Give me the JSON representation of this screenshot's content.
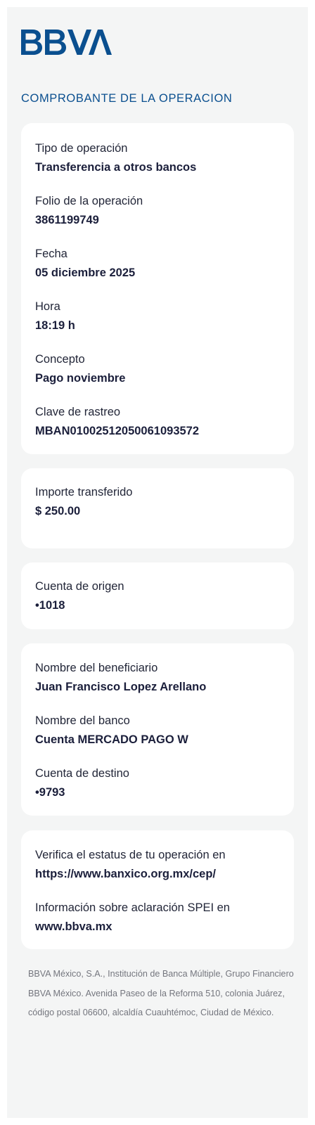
{
  "brand": {
    "name": "BBVA",
    "color": "#0a4f8f"
  },
  "header": {
    "title": "COMPROBANTE DE LA OPERACION"
  },
  "operation": {
    "type_label": "Tipo de operación",
    "type_value": "Transferencia a otros bancos",
    "folio_label": "Folio de la operación",
    "folio_value": "3861199749",
    "date_label": "Fecha",
    "date_value": "05 diciembre 2025",
    "time_label": "Hora",
    "time_value": "18:19 h",
    "concept_label": "Concepto",
    "concept_value": "Pago noviembre",
    "tracking_label": "Clave de rastreo",
    "tracking_value": "MBAN01002512050061093572"
  },
  "amount": {
    "label": "Importe transferido",
    "value": "$ 250.00"
  },
  "origin": {
    "label": "Cuenta de origen",
    "value": "•1018"
  },
  "beneficiary": {
    "name_label": "Nombre del beneficiario",
    "name_value": "Juan Francisco Lopez Arellano",
    "bank_label": "Nombre del banco",
    "bank_value": "Cuenta MERCADO PAGO W",
    "account_label": "Cuenta de destino",
    "account_value": "•9793"
  },
  "verify": {
    "status_label": "Verifica el estatus de tu operación en",
    "status_link": "https://www.banxico.org.mx/cep/",
    "info_label": "Información sobre aclaración SPEI en",
    "info_link": "www.bbva.mx"
  },
  "footer": {
    "legal": "BBVA México, S.A., Institución de Banca Múltiple, Grupo Financiero BBVA México. Avenida Paseo de la Reforma 510, colonia Juárez, código postal 06600, alcaldía Cuauhtémoc, Ciudad de México."
  }
}
